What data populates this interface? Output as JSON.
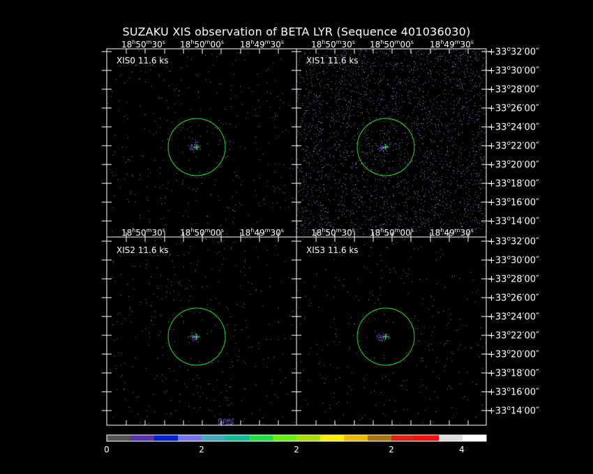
{
  "title": "SUZAKU XIS observation of BETA LYR  (Sequence 401036030)",
  "panels": [
    {
      "label": "XIS0 11.6 ks"
    },
    {
      "label": "XIS1 11.6 ks"
    },
    {
      "label": "XIS2 11.6 ks"
    },
    {
      "label": "XIS3 11.6 ks"
    }
  ],
  "ra_labels": {
    "top": [
      {
        "h": "18",
        "m": "50",
        "s": "30"
      },
      {
        "h": "18",
        "m": "50",
        "s": "00"
      },
      {
        "h": "18",
        "m": "49",
        "s": "30"
      }
    ]
  },
  "dec_labels": [
    [
      "+33",
      "32",
      "00"
    ],
    [
      "+33",
      "30",
      "00"
    ],
    [
      "+33",
      "28",
      "00"
    ],
    [
      "+33",
      "26",
      "00"
    ],
    [
      "+33",
      "24",
      "00"
    ],
    [
      "+33",
      "22",
      "00"
    ],
    [
      "+33",
      "20",
      "00"
    ],
    [
      "+33",
      "18",
      "00"
    ],
    [
      "+33",
      "16",
      "00"
    ],
    [
      "+33",
      "14",
      "00"
    ]
  ],
  "colorbar": {
    "colors": [
      "#555555",
      "#5533aa",
      "#0022cc",
      "#7777ee",
      "#44aabb",
      "#11bb99",
      "#22dd44",
      "#66ee11",
      "#aadd00",
      "#ffee00",
      "#eebb00",
      "#aa7711",
      "#dd2211",
      "#ee1111",
      "#dddddd",
      "#ffffff"
    ],
    "tick_labels": [
      "0",
      "2",
      "2",
      "2",
      "4"
    ]
  },
  "colors": {
    "background": "#000000",
    "frame": "#ffffff",
    "circle": "#22dd22",
    "source_marker": "#33ff33",
    "events": "#8877cc"
  }
}
